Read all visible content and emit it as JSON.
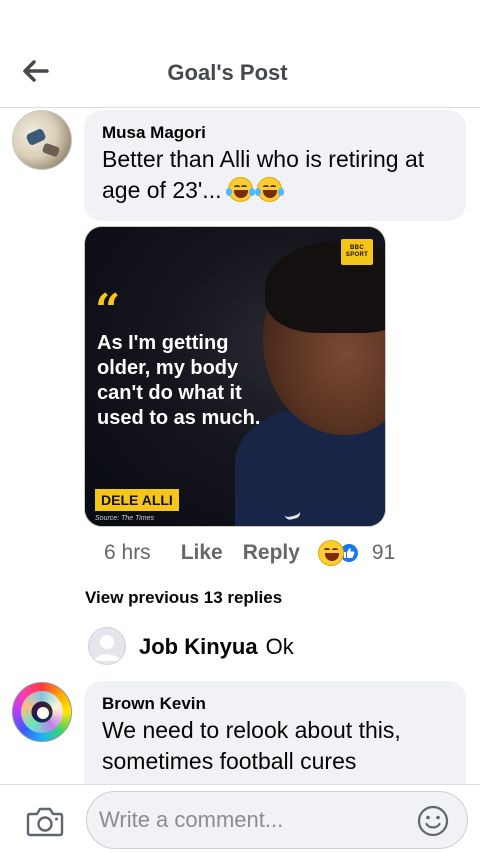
{
  "header": {
    "title": "Goal's Post",
    "back_icon": "arrow-left-icon"
  },
  "comments": [
    {
      "author": "Musa Magori",
      "text": "Better than Alli who is retiring at age of 23'...",
      "emojis": [
        "laughing-tears-emoji",
        "laughing-tears-emoji"
      ],
      "image": {
        "badge_line1": "BBC",
        "badge_line2": "SPORT",
        "quote": "As I'm getting older, my body can't do what it used to as much.",
        "quote_mark": "“",
        "name_tag": "DELE ALLI",
        "source": "Source: The Times"
      },
      "meta": {
        "time": "6 hrs",
        "like_label": "Like",
        "reply_label": "Reply",
        "reaction_count": "91",
        "reaction_icons": [
          "haha-reaction-icon",
          "like-reaction-icon"
        ]
      }
    }
  ],
  "view_previous": "View previous 13 replies",
  "reply": {
    "author": "Job Kinyua",
    "text": "Ok"
  },
  "comment2": {
    "author": "Brown Kevin",
    "text": "We need to relook about this, sometimes football cures"
  },
  "composer": {
    "placeholder": "Write a comment...",
    "camera_icon": "camera-icon",
    "emoji_icon": "smiley-icon"
  },
  "colors": {
    "bubble": "#f0f2f5",
    "secondary_text": "#65676b",
    "like_blue": "#1877f2",
    "bbc_yellow": "#f5c518"
  }
}
